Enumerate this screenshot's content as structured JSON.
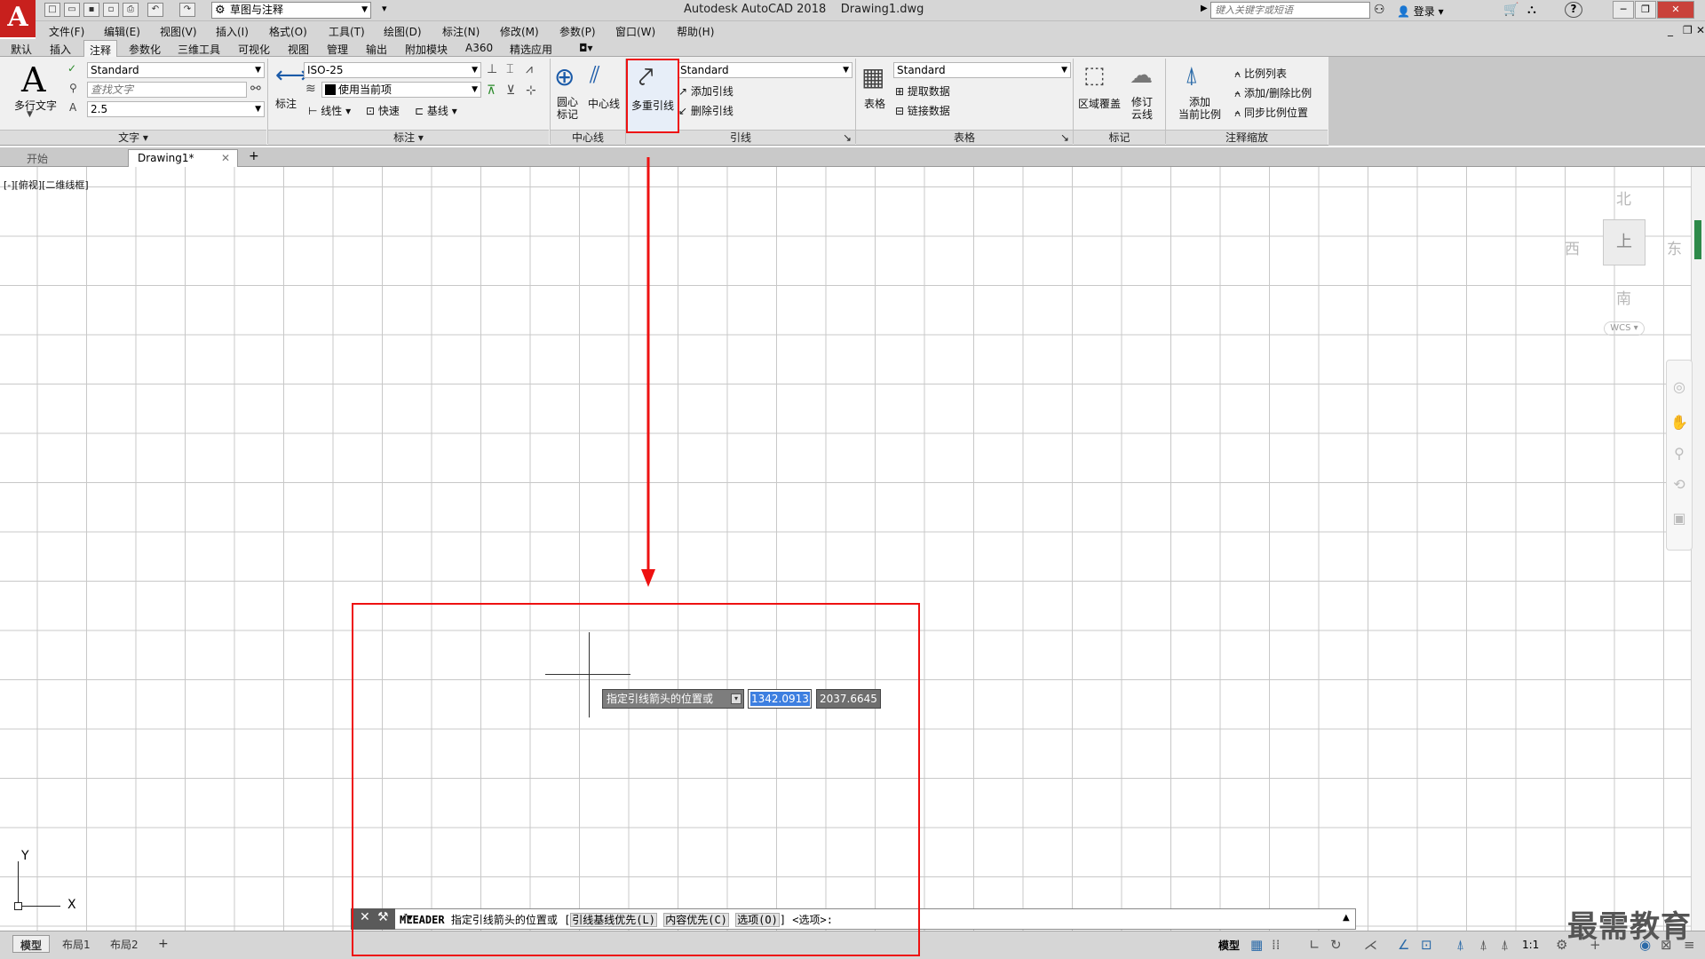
{
  "app": {
    "title": "Autodesk AutoCAD 2018",
    "document": "Drawing1.dwg",
    "logo_letter": "A",
    "workspace": "草图与注释",
    "search_placeholder": "键入关键字或短语",
    "login": "登录",
    "help": "?"
  },
  "menus": [
    "文件(F)",
    "编辑(E)",
    "视图(V)",
    "插入(I)",
    "格式(O)",
    "工具(T)",
    "绘图(D)",
    "标注(N)",
    "修改(M)",
    "参数(P)",
    "窗口(W)",
    "帮助(H)"
  ],
  "ribbon_tabs": [
    "默认",
    "插入",
    "注释",
    "参数化",
    "三维工具",
    "可视化",
    "视图",
    "管理",
    "输出",
    "附加模块",
    "A360",
    "精选应用"
  ],
  "active_ribbon_tab": "注释",
  "ribbon": {
    "text_panel": {
      "title": "文字",
      "mtext_label": "多行文字",
      "style": "Standard",
      "find_placeholder": "查找文字",
      "height": "2.5"
    },
    "dim_panel": {
      "title": "标注",
      "dim_label": "标注",
      "style": "ISO-25",
      "layer": "使用当前项",
      "linear": "线性",
      "quick": "快速",
      "baseline": "基线"
    },
    "centerline_panel": {
      "title": "中心线",
      "center_mark": "圆心\n标记",
      "centerline": "中心线"
    },
    "leader_panel": {
      "title": "引线",
      "multileader": "多重引线",
      "style": "Standard",
      "add_leader": "添加引线",
      "remove_leader": "删除引线"
    },
    "table_panel": {
      "title": "表格",
      "table": "表格",
      "style": "Standard",
      "extract": "提取数据",
      "link": "链接数据"
    },
    "markup_panel": {
      "title": "标记",
      "wipeout": "区域覆盖",
      "revcloud": "修订\n云线"
    },
    "scale_panel": {
      "title": "注释缩放",
      "add_scale": "添加\n当前比例",
      "scale_list": "比例列表",
      "add_delete": "添加/删除比例",
      "sync": "同步比例位置"
    }
  },
  "doc_tabs": [
    "开始",
    "Drawing1*"
  ],
  "viewport_label": "[-][俯视][二维线框]",
  "viewcube": {
    "north": "北",
    "south": "南",
    "east": "东",
    "west": "西",
    "face": "上",
    "wcs": "WCS"
  },
  "ucs": {
    "x": "X",
    "y": "Y"
  },
  "dynamic_input": {
    "prompt": "指定引线箭头的位置或",
    "x_value": "1342.0913",
    "y_value": "2037.6645"
  },
  "command_line": {
    "command": "MLEADER",
    "prompt": "指定引线箭头的位置或",
    "open_bracket": "[",
    "options": [
      "引线基线优先(L)",
      "内容优先(C)",
      "选项(O)"
    ],
    "close": "] <选项>:"
  },
  "layout_tabs": [
    "模型",
    "布局1",
    "布局2"
  ],
  "status": {
    "model": "模型",
    "scale": "1:1"
  },
  "watermark": "最需教育"
}
